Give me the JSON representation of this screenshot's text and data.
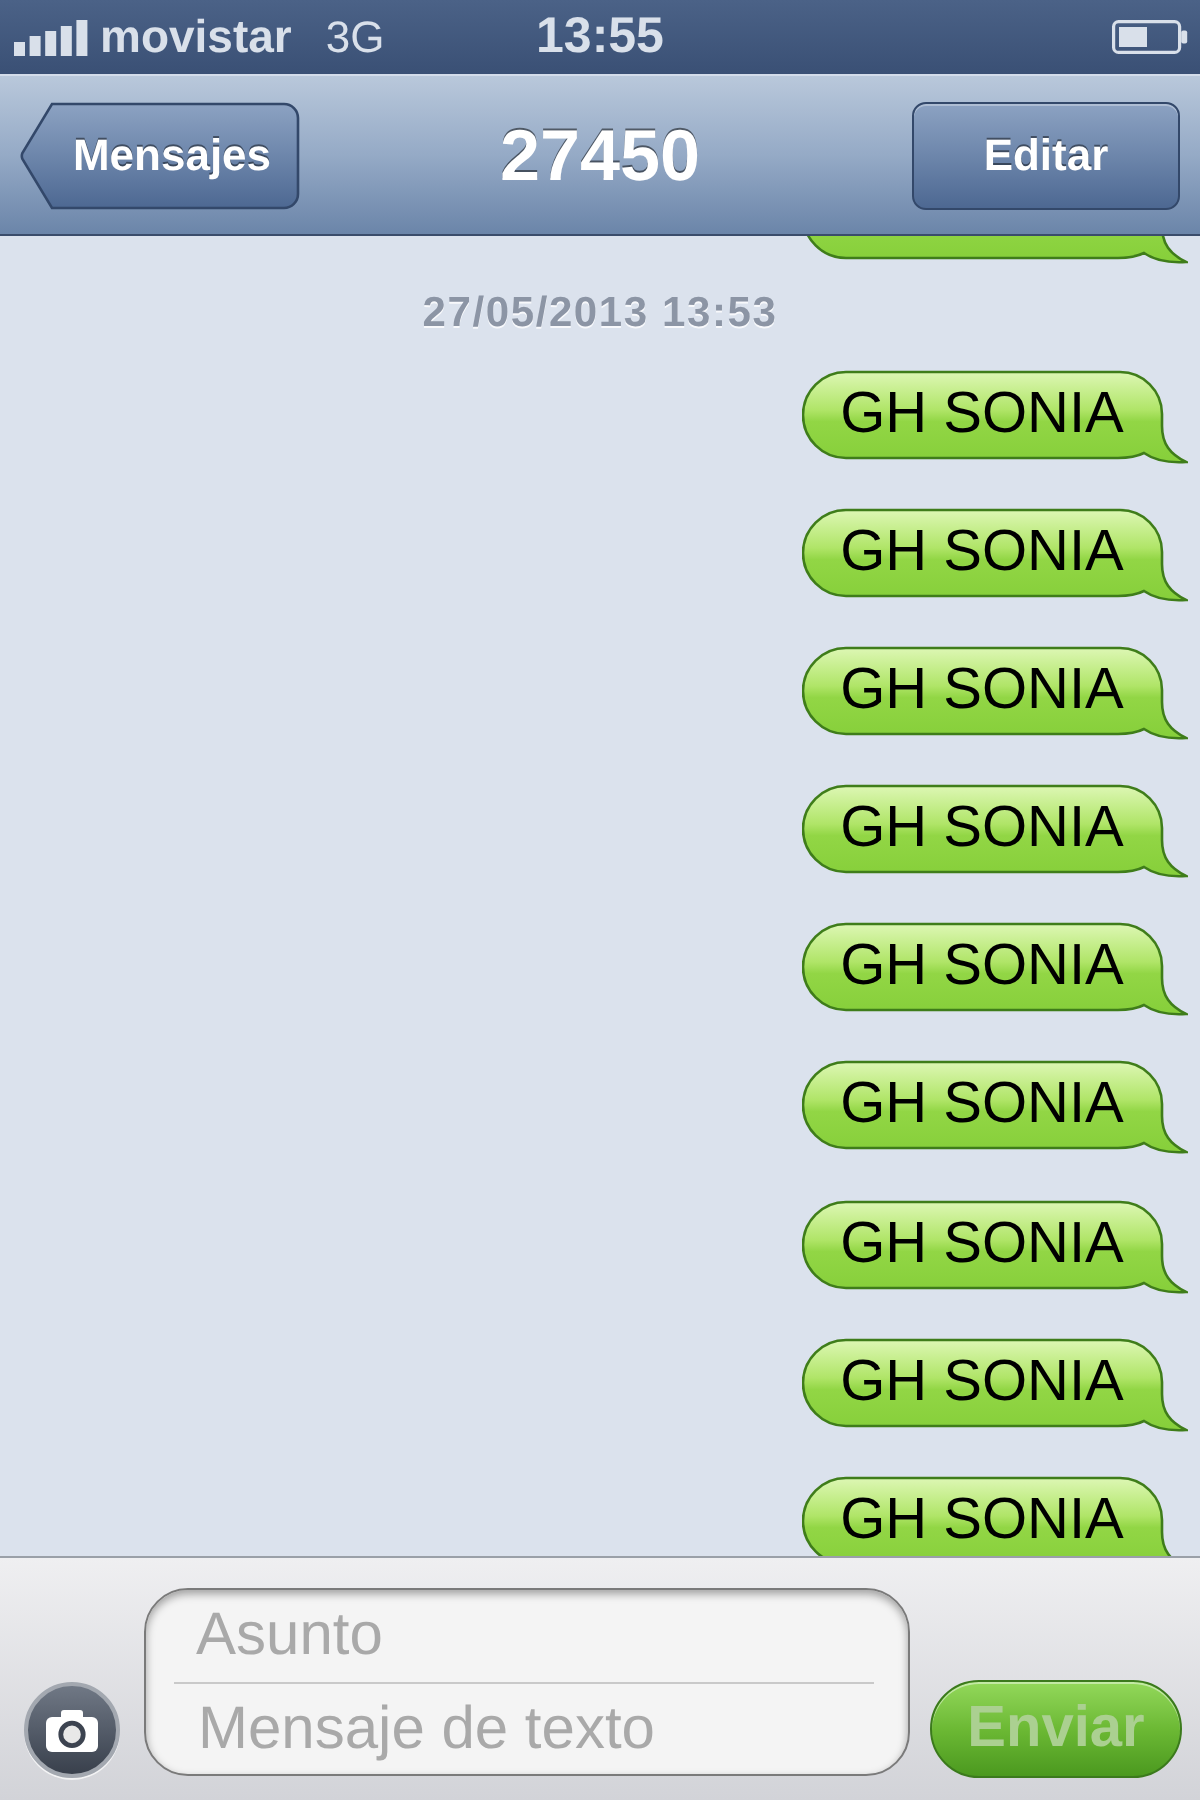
{
  "status_bar": {
    "carrier": "movistar",
    "network": "3G",
    "time": "13:55"
  },
  "nav_bar": {
    "back_button": "Mensajes",
    "title": "27450",
    "edit_button": "Editar"
  },
  "thread": [
    {
      "kind": "bubble_end"
    },
    {
      "kind": "date",
      "text": "27/05/2013 13:53"
    },
    {
      "kind": "sent",
      "text": "GH SONIA"
    },
    {
      "kind": "sent",
      "text": "GH SONIA"
    },
    {
      "kind": "sent",
      "text": "GH SONIA"
    },
    {
      "kind": "sent",
      "text": "GH SONIA"
    },
    {
      "kind": "sent",
      "text": "GH SONIA"
    },
    {
      "kind": "sent",
      "text": "GH SONIA"
    },
    {
      "kind": "sent",
      "text": "GH SONIA"
    },
    {
      "kind": "sent",
      "text": "GH SONIA"
    },
    {
      "kind": "sent",
      "text": "GH SONIA"
    }
  ],
  "composer": {
    "subject": {
      "placeholder": "Asunto"
    },
    "message": {
      "placeholder": "Mensaje de texto"
    },
    "send_button": {
      "label": "Enviar",
      "disabled": true
    }
  }
}
